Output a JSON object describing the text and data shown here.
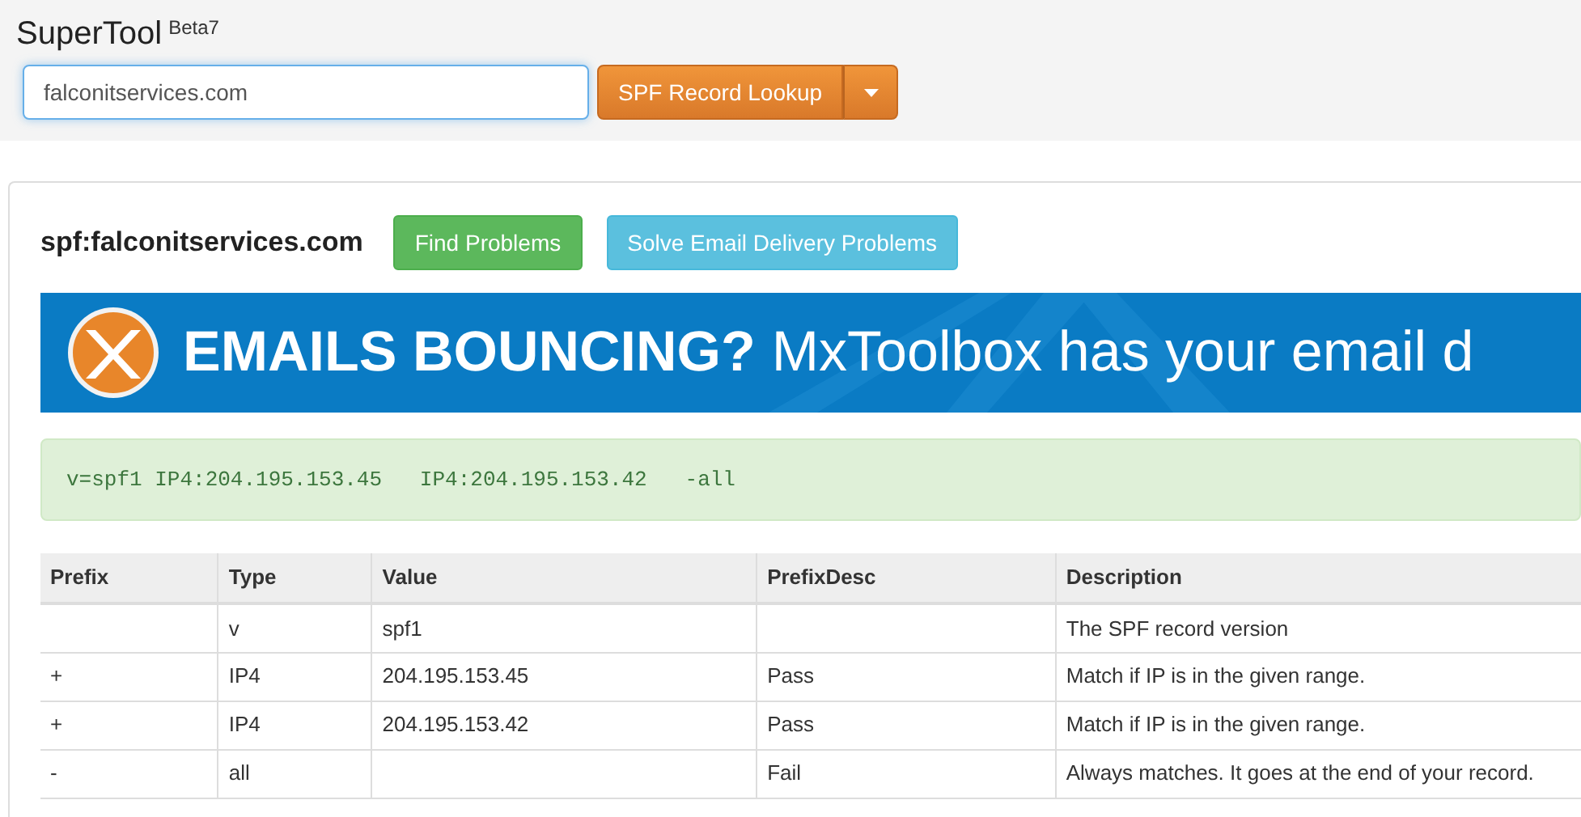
{
  "header": {
    "title": "SuperTool",
    "badge": "Beta7"
  },
  "search": {
    "value": "falconitservices.com",
    "focused": true
  },
  "lookup_button": {
    "label": "SPF Record Lookup"
  },
  "result": {
    "heading": "spf:falconitservices.com",
    "buttons": [
      {
        "label": "Find Problems",
        "kind": "success"
      },
      {
        "label": "Solve Email Delivery Problems",
        "kind": "info"
      }
    ],
    "banner": {
      "headline": "EMAILS BOUNCING?",
      "tagline": "MxToolbox has your email d"
    },
    "record": "v=spf1 IP4:204.195.153.45   IP4:204.195.153.42   -all",
    "table": {
      "columns": [
        "Prefix",
        "Type",
        "Value",
        "PrefixDesc",
        "Description"
      ],
      "rows": [
        [
          "",
          "v",
          "spf1",
          "",
          "The SPF record version"
        ],
        [
          "+",
          "IP4",
          "204.195.153.45",
          "Pass",
          "Match if IP is in the given range."
        ],
        [
          "+",
          "IP4",
          "204.195.153.42",
          "Pass",
          "Match if IP is in the given range."
        ],
        [
          "-",
          "all",
          "",
          "Fail",
          "Always matches. It goes at the end of your record."
        ]
      ]
    }
  }
}
